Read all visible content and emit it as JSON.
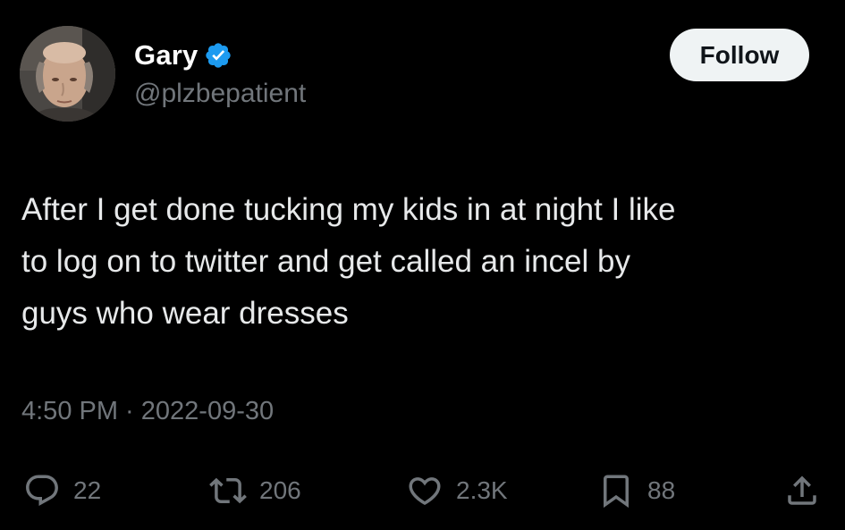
{
  "author": {
    "display_name": "Gary",
    "handle": "@plzbepatient",
    "verified": true,
    "verified_color": "#1d9bf0"
  },
  "follow_button": {
    "label": "Follow"
  },
  "tweet": {
    "text": "After I get done tucking my kids in at night I like\nto log on to twitter and get called an incel by\nguys who wear dresses",
    "timestamp": "4:50 PM · 2022-09-30"
  },
  "actions": {
    "reply": {
      "icon": "reply-icon",
      "count": "22"
    },
    "retweet": {
      "icon": "retweet-icon",
      "count": "206"
    },
    "like": {
      "icon": "heart-icon",
      "count": "2.3K"
    },
    "bookmark": {
      "icon": "bookmark-icon",
      "count": "88"
    },
    "share": {
      "icon": "share-icon"
    }
  },
  "colors": {
    "background": "#000000",
    "text_primary": "#e7e9ea",
    "text_secondary": "#71767b",
    "button_bg": "#eff3f4"
  }
}
